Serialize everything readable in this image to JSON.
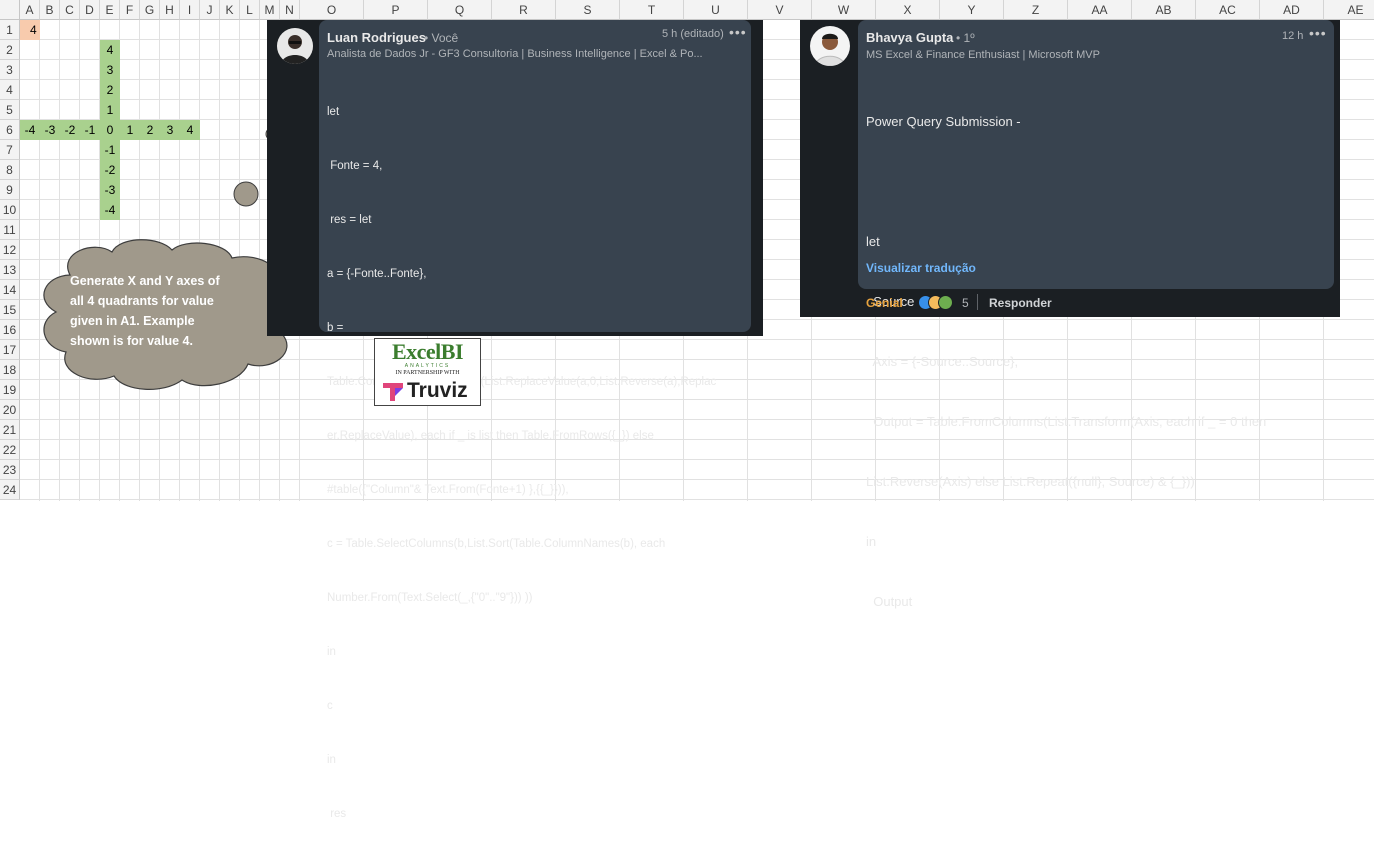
{
  "columns": [
    "A",
    "B",
    "C",
    "D",
    "E",
    "F",
    "G",
    "H",
    "I",
    "J",
    "K",
    "L",
    "M",
    "N",
    "O",
    "P",
    "Q",
    "R",
    "S",
    "T",
    "U",
    "V",
    "W",
    "X",
    "Y",
    "Z",
    "AA",
    "AB",
    "AC",
    "AD",
    "AE"
  ],
  "rows": [
    "1",
    "2",
    "3",
    "4",
    "5",
    "6",
    "7",
    "8",
    "9",
    "10",
    "11",
    "12",
    "13",
    "14",
    "15",
    "16",
    "17",
    "18",
    "19",
    "20",
    "21",
    "22",
    "23",
    "24"
  ],
  "cells": {
    "A1": "4",
    "E2": "4",
    "E3": "3",
    "E4": "2",
    "E5": "1",
    "A6": "-4",
    "B6": "-3",
    "C6": "-2",
    "D6": "-1",
    "E6": "0",
    "F6": "1",
    "G6": "2",
    "H6": "3",
    "I6": "4",
    "E7": "-1",
    "E8": "-2",
    "E9": "-3",
    "E10": "-4"
  },
  "cloud": {
    "lines": [
      "Generate X and Y axes of",
      "all 4 quadrants for value",
      "given in A1. Example",
      "shown is for value 4."
    ]
  },
  "comment1": {
    "name": "Luan Rodrigues",
    "badge": "• Você",
    "time": "5 h (editado)",
    "headline": "Analista de Dados Jr - GF3 Consultoria | Business Intelligence | Excel & Po...",
    "code": [
      "let",
      " Fonte = 4,",
      " res = let",
      "a = {-Fonte..Fonte},",
      "b =",
      "Table.Combine(List.Transform(List.ReplaceValue(a,0,List.Reverse(a),Replac",
      "er.ReplaceValue), each if _ is list then Table.FromRows({_}) else",
      "#table({\"Column\"& Text.From(Fonte+1) },{{_}})),",
      "c = Table.SelectColumns(b,List.Sort(Table.ColumnNames(b), each",
      "Number.From(Text.Select(_,{\"0\"..\"9\"})) ))",
      "in",
      "c",
      "in",
      " res"
    ]
  },
  "comment2": {
    "name": "Bhavya Gupta",
    "badge": "• 1º",
    "time": "12 h",
    "headline": "MS Excel & Finance Enthusiast | Microsoft MVP",
    "code": [
      "Power Query Submission -",
      "",
      "let",
      "  Source = 4,",
      "  Axis = {-Source..Source},",
      "  Output = Table.FromColumns(List.Transform(Axis, each if _ = 0 then",
      "List.Reverse(Axis) else List.Repeat({null}, Source) & {_}))",
      "in",
      "  Output"
    ],
    "translate": "Visualizar tradução",
    "reaction_label": "Genial",
    "reaction_count": "5",
    "reply": "Responder"
  },
  "logo": {
    "brand": "ExcelBI",
    "brand_sub": "ANALYTICS",
    "partner": "IN PARTNERSHIP WITH",
    "truviz": "Truviz"
  },
  "colors": {
    "green": "#a9d18e",
    "orange": "#f8cbad",
    "cloud": "#a0998b",
    "card": "#1b1f23",
    "bubble": "#38434f",
    "link": "#71b7fb"
  }
}
